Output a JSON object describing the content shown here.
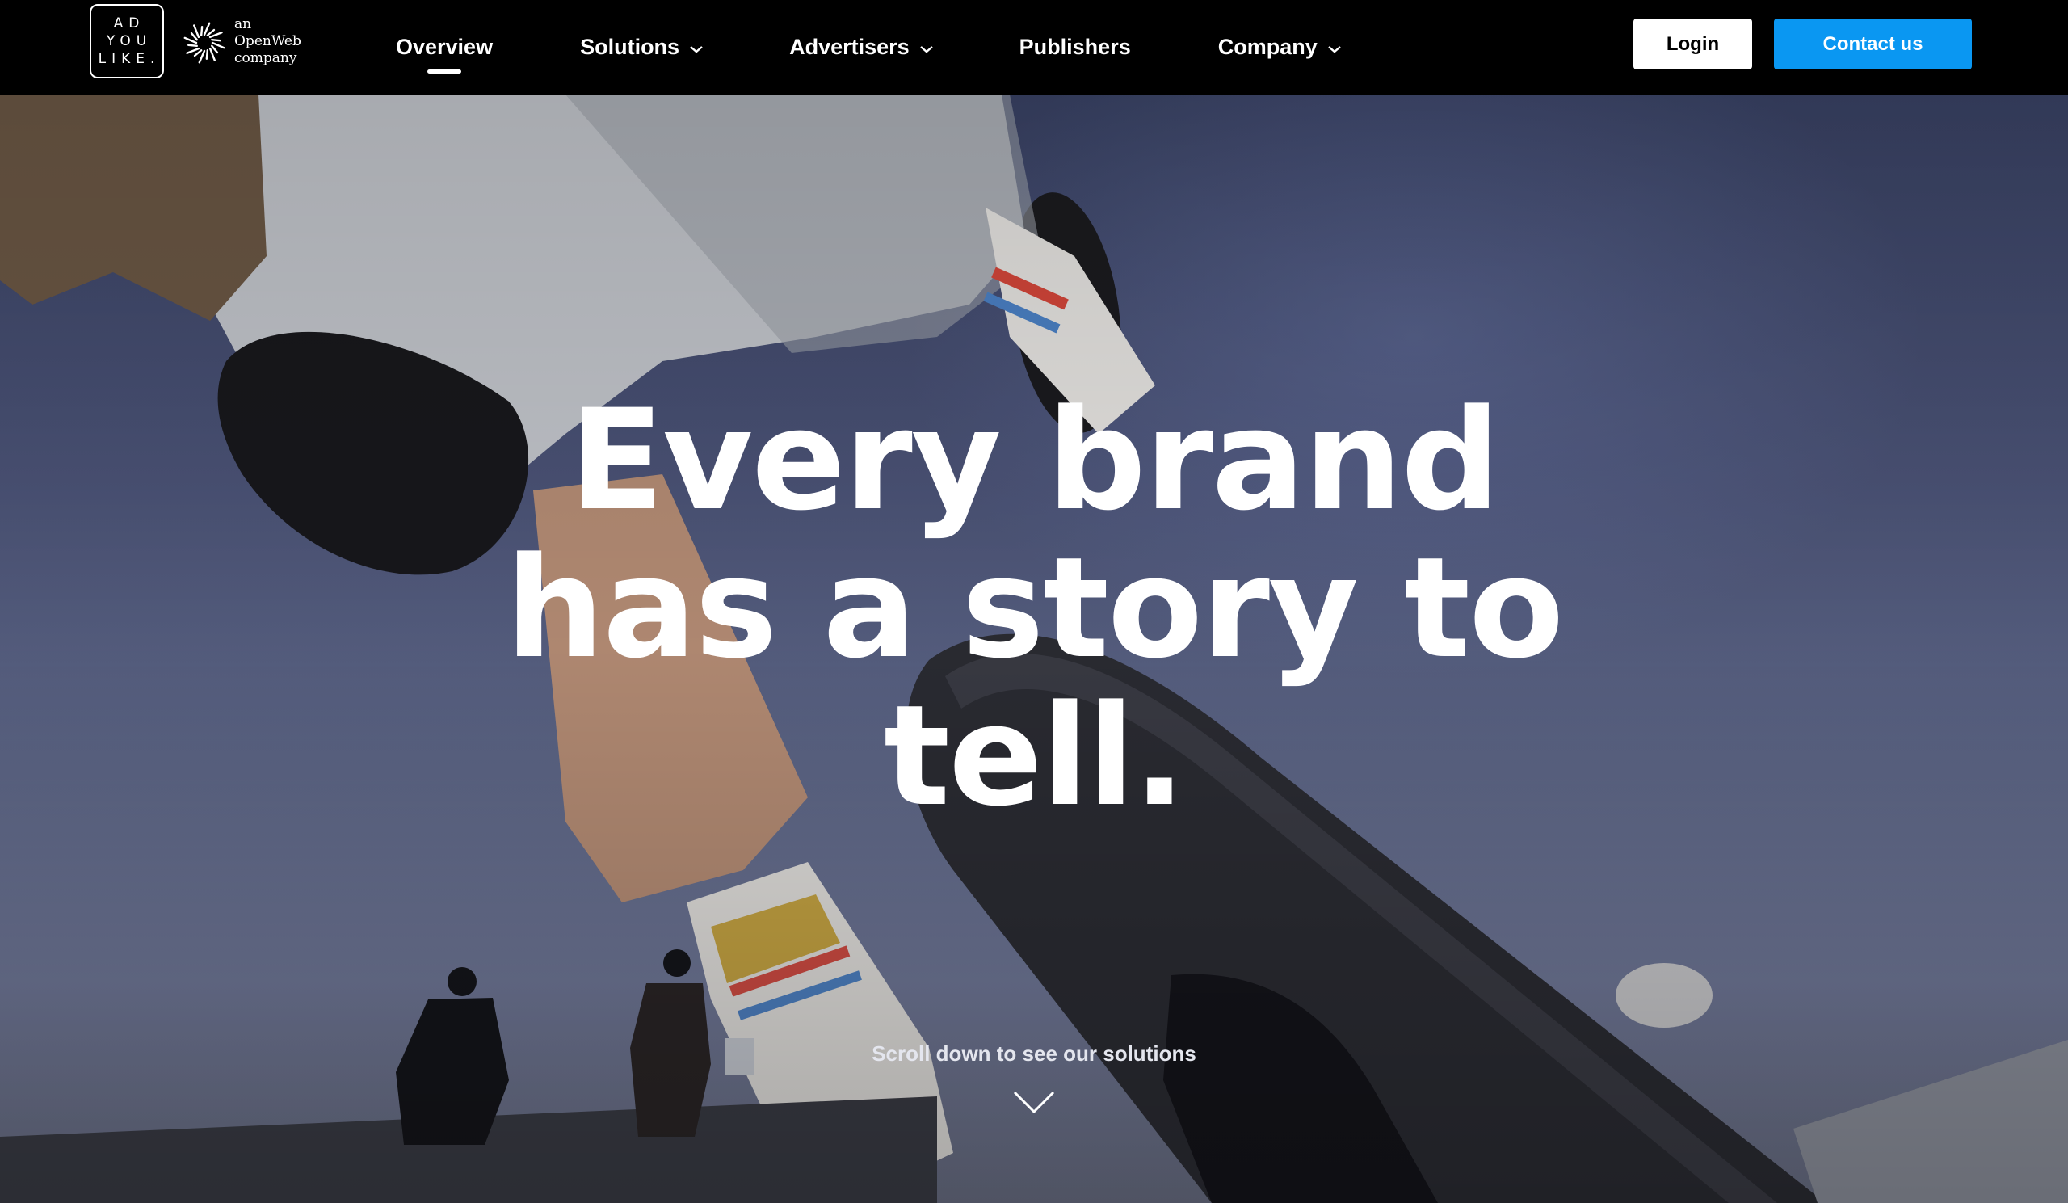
{
  "brand": {
    "logo_lines": [
      "AD",
      "YOU",
      "LIKE."
    ],
    "partner_lines": [
      "an",
      "OpenWeb",
      "company"
    ]
  },
  "nav": {
    "items": [
      {
        "label": "Overview",
        "has_dropdown": false,
        "active": true
      },
      {
        "label": "Solutions",
        "has_dropdown": true,
        "active": false
      },
      {
        "label": "Advertisers",
        "has_dropdown": true,
        "active": false
      },
      {
        "label": "Publishers",
        "has_dropdown": false,
        "active": false
      },
      {
        "label": "Company",
        "has_dropdown": true,
        "active": false
      }
    ],
    "login_label": "Login",
    "contact_label": "Contact us"
  },
  "hero": {
    "headline_lines": [
      "Every brand",
      "has a story to",
      "tell."
    ],
    "scroll_hint": "Scroll down to see our solutions"
  },
  "icons": {
    "dropdown": "chevron-down-icon",
    "scroll": "chevron-down-icon",
    "partner_mark": "openweb-sunburst-icon"
  },
  "colors": {
    "header_bg": "#000000",
    "contact_button": "#0a97f2",
    "login_button": "#ffffff",
    "text": "#ffffff"
  }
}
